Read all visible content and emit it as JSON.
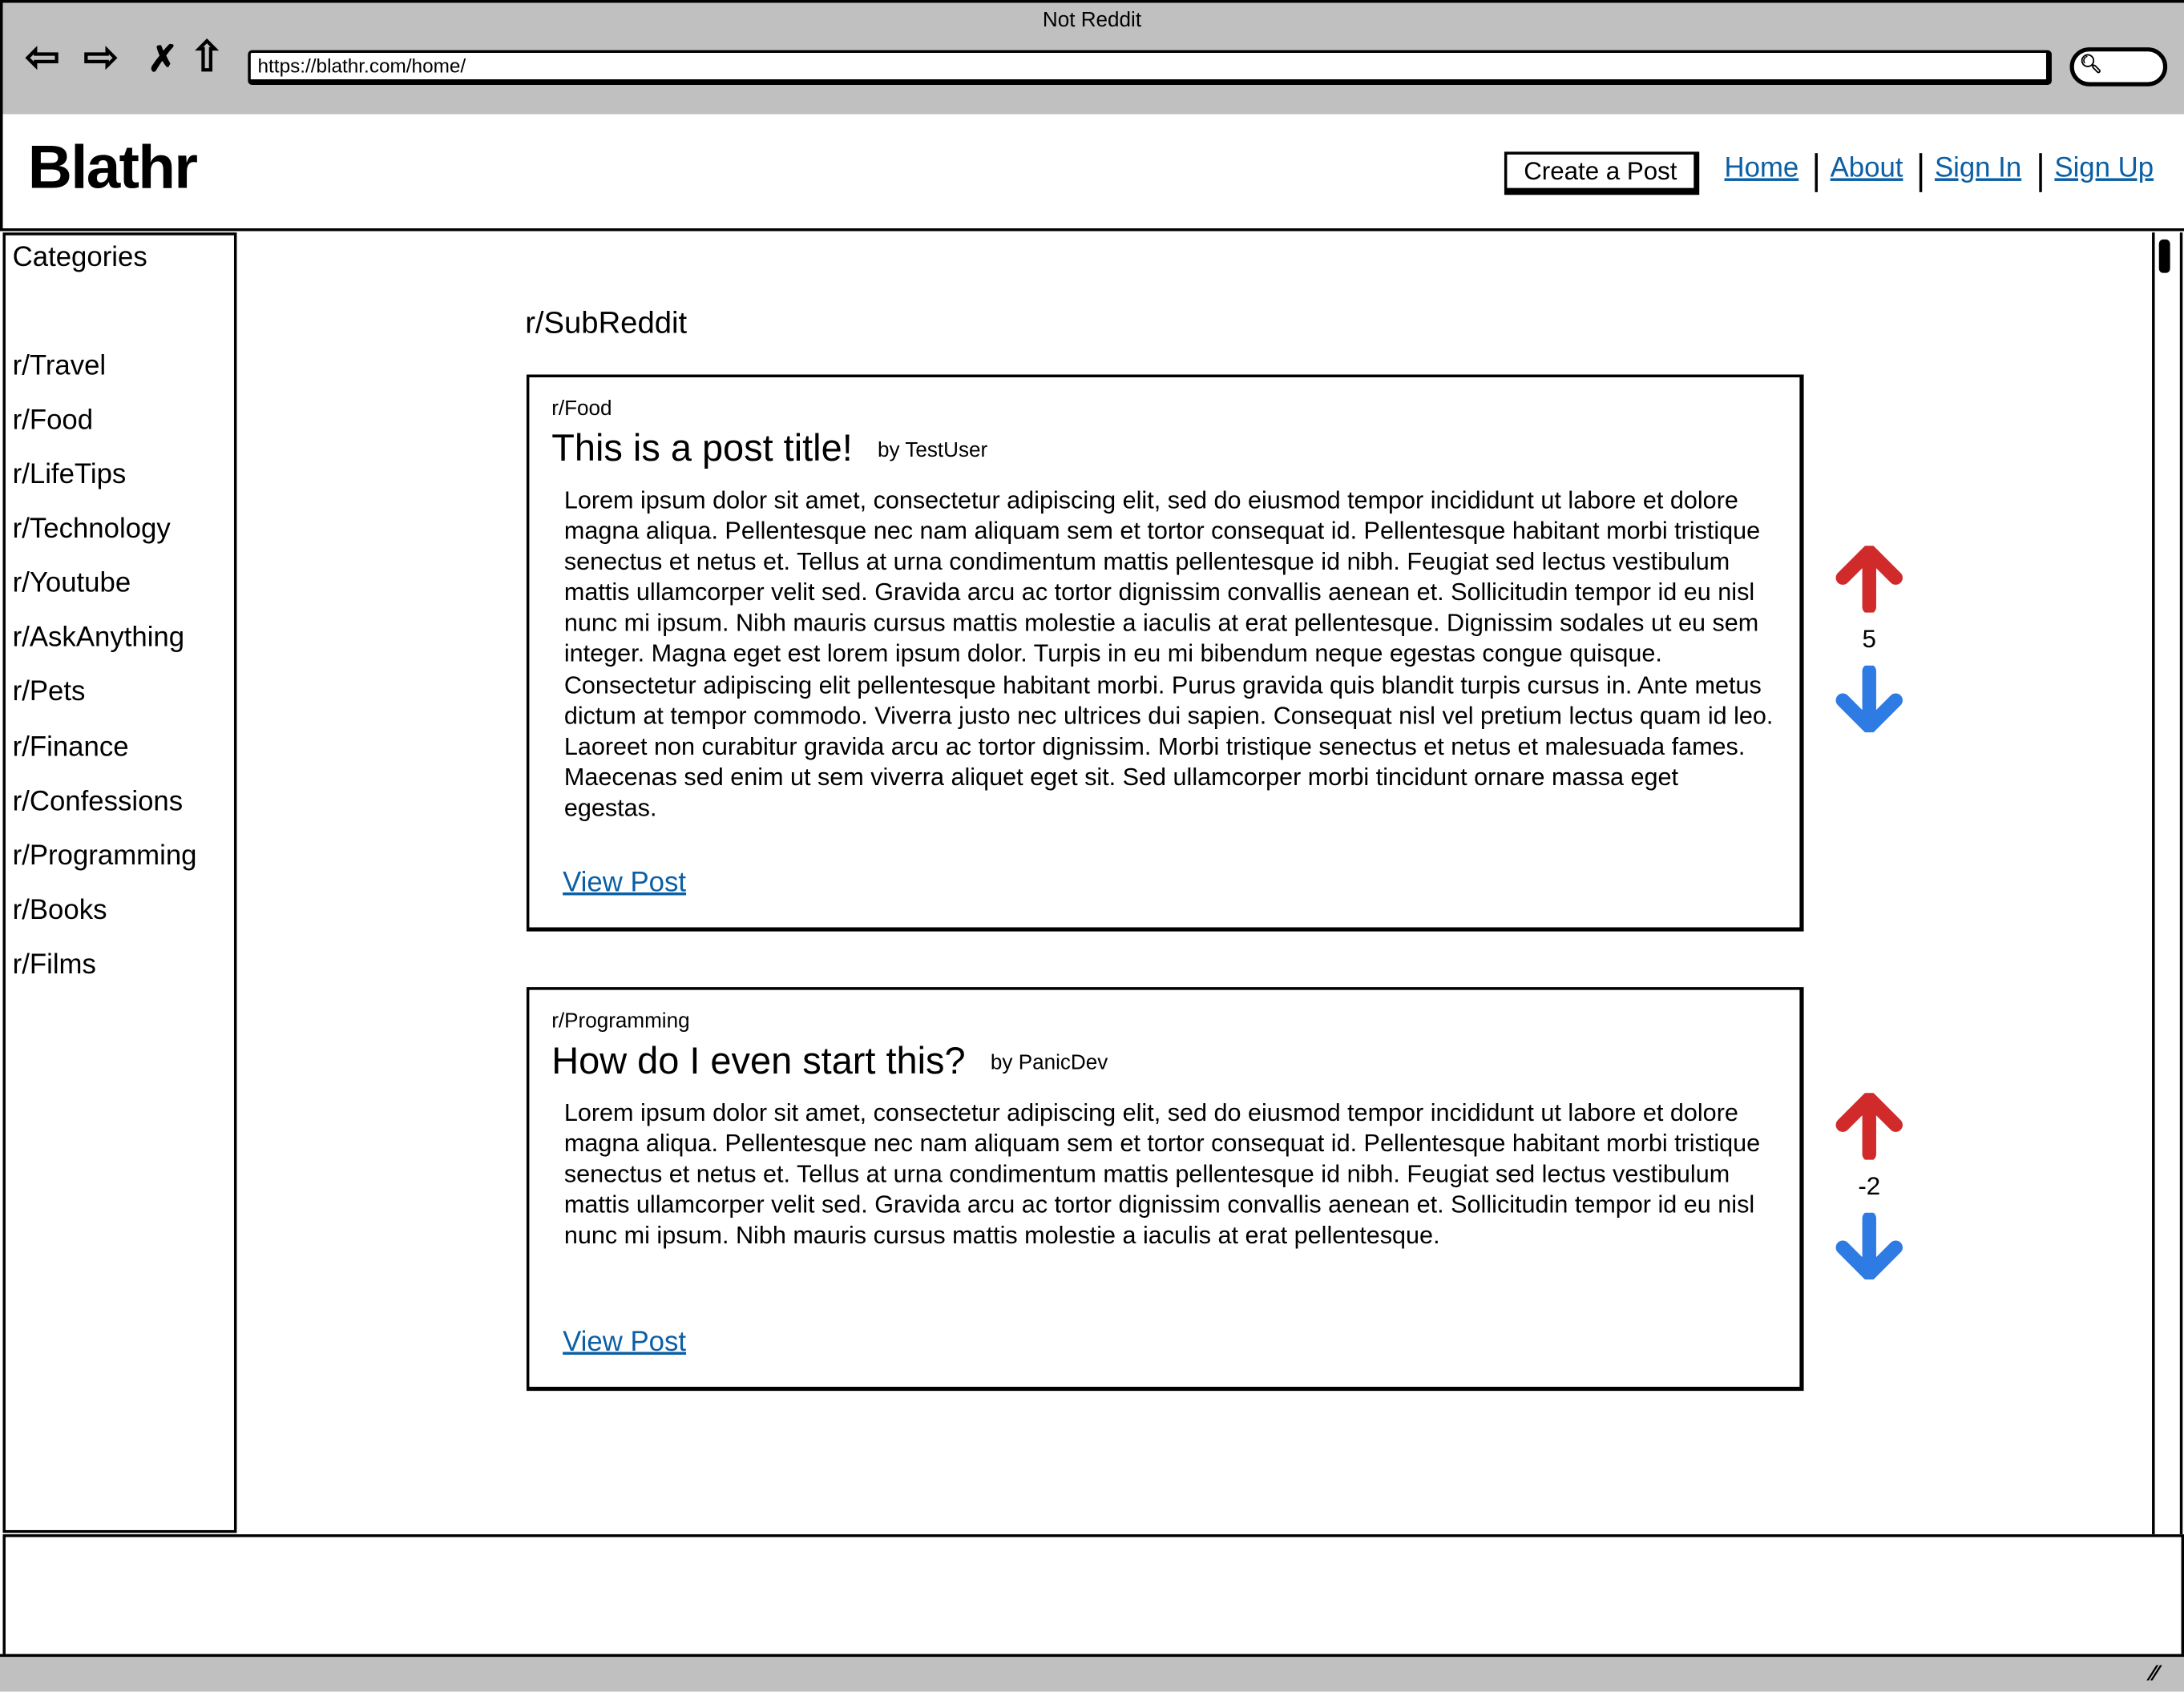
{
  "browser": {
    "window_title": "Not Reddit",
    "url": "https://blathr.com/home/",
    "icons": [
      "back-arrow-icon",
      "forward-arrow-icon",
      "close-x-icon",
      "home-icon",
      "search-icon",
      "resize-grip-icon"
    ]
  },
  "header": {
    "logo": "Blathr",
    "create_post_label": "Create a Post",
    "links": [
      "Home",
      "About",
      "Sign In",
      "Sign Up"
    ]
  },
  "sidebar": {
    "title": "Categories",
    "items": [
      "r/Travel",
      "r/Food",
      "r/LifeTips",
      "r/Technology",
      "r/Youtube",
      "r/AskAnything",
      "r/Pets",
      "r/Finance",
      "r/Confessions",
      "r/Programming",
      "r/Books",
      "r/Films"
    ]
  },
  "main": {
    "title": "r/SubReddit",
    "posts": [
      {
        "subreddit": "r/Food",
        "title": "This is a post title!",
        "author": "by TestUser",
        "body": "Lorem ipsum dolor sit amet, consectetur adipiscing elit, sed do eiusmod tempor incididunt ut labore et dolore magna aliqua. Pellentesque nec nam aliquam sem et tortor consequat id. Pellentesque habitant morbi tristique senectus et netus et. Tellus at urna condimentum mattis pellentesque id nibh. Feugiat sed lectus vestibulum mattis ullamcorper velit sed. Gravida arcu ac tortor dignissim convallis aenean et. Sollicitudin tempor id eu nisl nunc mi ipsum. Nibh mauris cursus mattis molestie a iaculis at erat pellentesque. Dignissim sodales ut eu sem integer. Magna eget est lorem ipsum dolor. Turpis in eu mi bibendum neque egestas congue quisque. Consectetur adipiscing elit pellentesque habitant morbi. Purus gravida quis blandit turpis cursus in. Ante metus dictum at tempor commodo. Viverra justo nec ultrices dui sapien. Consequat nisl vel pretium lectus quam id leo. Laoreet non curabitur gravida arcu ac tortor dignissim. Morbi tristique senectus et netus et malesuada fames. Maecenas sed enim ut sem viverra aliquet eget sit. Sed ullamcorper morbi tincidunt ornare massa eget egestas.",
        "view_label": "View Post",
        "score": "5"
      },
      {
        "subreddit": "r/Programming",
        "title": "How do I even start this?",
        "author": "by PanicDev",
        "body": "Lorem ipsum dolor sit amet, consectetur adipiscing elit, sed do eiusmod tempor incididunt ut labore et dolore magna aliqua. Pellentesque nec nam aliquam sem et tortor consequat id. Pellentesque habitant morbi tristique senectus et netus et. Tellus at urna condimentum mattis pellentesque id nibh. Feugiat sed lectus vestibulum mattis ullamcorper velit sed. Gravida arcu ac tortor dignissim convallis aenean et. Sollicitudin tempor id eu nisl nunc mi ipsum. Nibh mauris cursus mattis molestie a iaculis at erat pellentesque.",
        "view_label": "View Post",
        "score": "-2"
      }
    ]
  },
  "colors": {
    "upvote": "#d12a2a",
    "downvote": "#2e7be4",
    "link": "#0b5fa5",
    "chrome": "#c0c0c0"
  }
}
